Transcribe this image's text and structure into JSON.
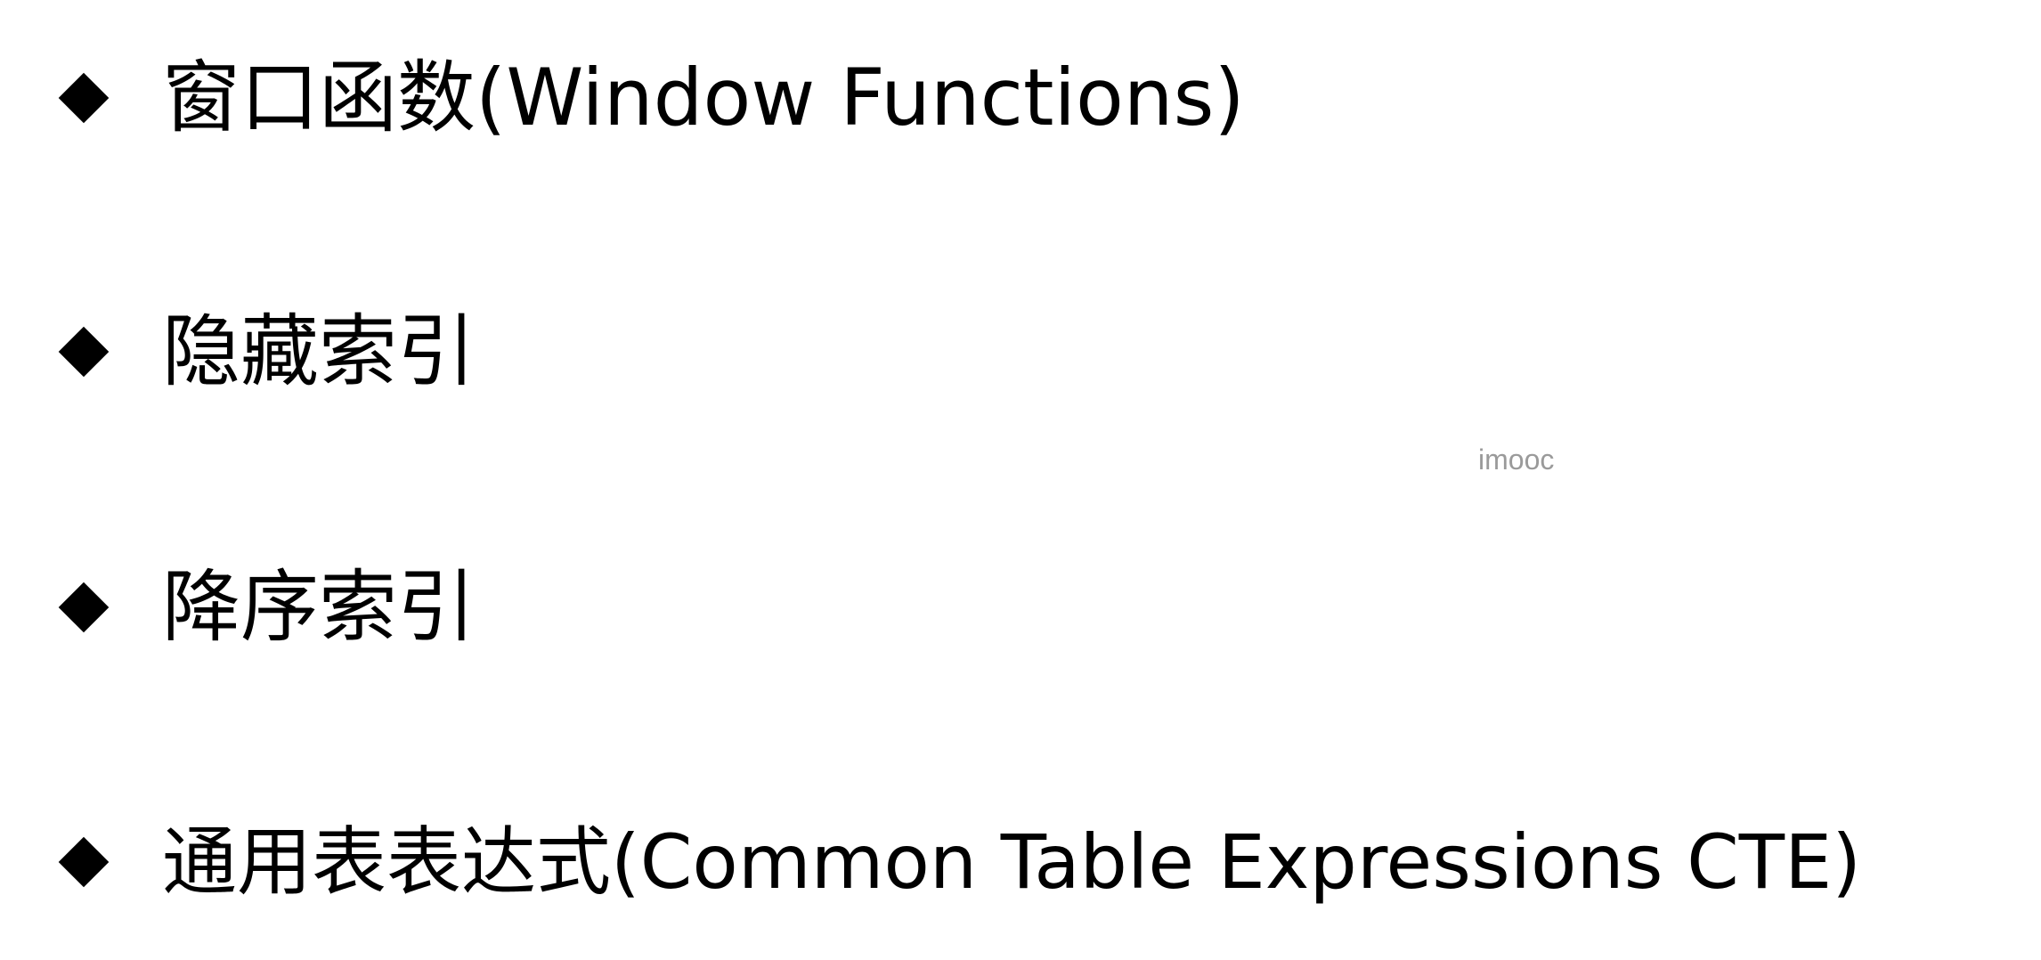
{
  "bullets": [
    {
      "icon": "diamond-bullet-icon",
      "text": "窗口函数(Window Functions)"
    },
    {
      "icon": "diamond-bullet-icon",
      "text": "隐藏索引"
    },
    {
      "icon": "diamond-bullet-icon",
      "text": "降序索引"
    },
    {
      "icon": "diamond-bullet-icon",
      "text": "通用表表达式(Common Table Expressions CTE)"
    }
  ],
  "watermark": "imooc",
  "colors": {
    "text": "#000000",
    "background": "#ffffff",
    "watermark": "#9a9a9a"
  }
}
